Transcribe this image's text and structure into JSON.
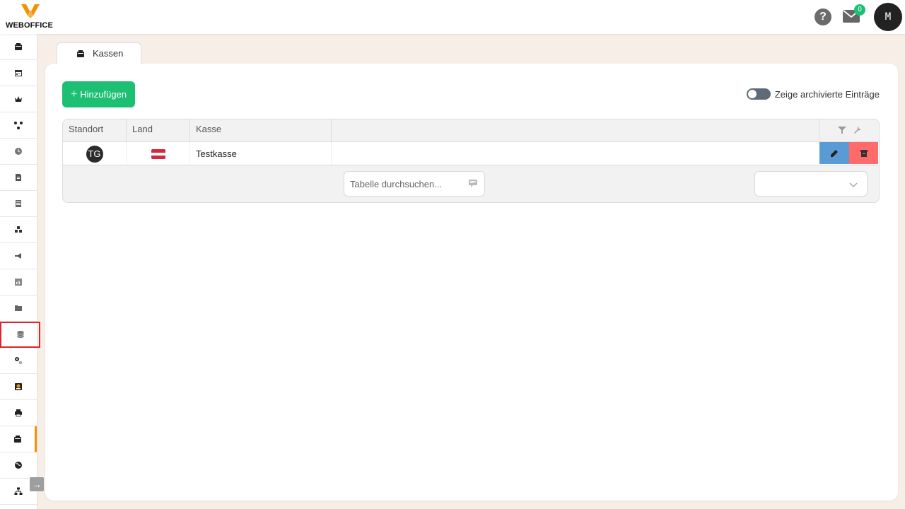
{
  "app": {
    "logo_text": "WEBOFFICE",
    "brand_color": "#f39200"
  },
  "header": {
    "help_label": "?",
    "mail_badge": "0",
    "avatar_initial": "M"
  },
  "sidebar": {
    "items": [
      {
        "icon": "cash-register-icon"
      },
      {
        "icon": "calendar-icon"
      },
      {
        "icon": "crown-icon"
      },
      {
        "icon": "network-icon"
      },
      {
        "icon": "clock-icon"
      },
      {
        "icon": "document-icon"
      },
      {
        "icon": "list-document-icon"
      },
      {
        "icon": "boxes-icon"
      },
      {
        "icon": "megaphone-icon"
      },
      {
        "icon": "chart-icon"
      },
      {
        "icon": "folder-icon"
      },
      {
        "icon": "database-icon",
        "highlighted": true
      },
      {
        "icon": "settings-icon"
      },
      {
        "icon": "badge-icon"
      },
      {
        "icon": "printer-icon"
      },
      {
        "icon": "cash-register-icon",
        "active": true
      },
      {
        "icon": "globe-icon"
      },
      {
        "icon": "sitemap-icon"
      }
    ],
    "expand_label": "→"
  },
  "tab": {
    "label": "Kassen"
  },
  "toolbar": {
    "add_label": "Hinzufügen",
    "archive_toggle_label": "Zeige archivierte Einträge",
    "archive_toggle_on": false
  },
  "table": {
    "columns": [
      "Standort",
      "Land",
      "Kasse"
    ],
    "rows": [
      {
        "standort": "TG",
        "land": "AT",
        "kasse": "Testkasse"
      }
    ],
    "search_placeholder": "Tabelle durchsuchen...",
    "edit_color": "#5b9bd5",
    "delete_color": "#ff6b6b"
  }
}
